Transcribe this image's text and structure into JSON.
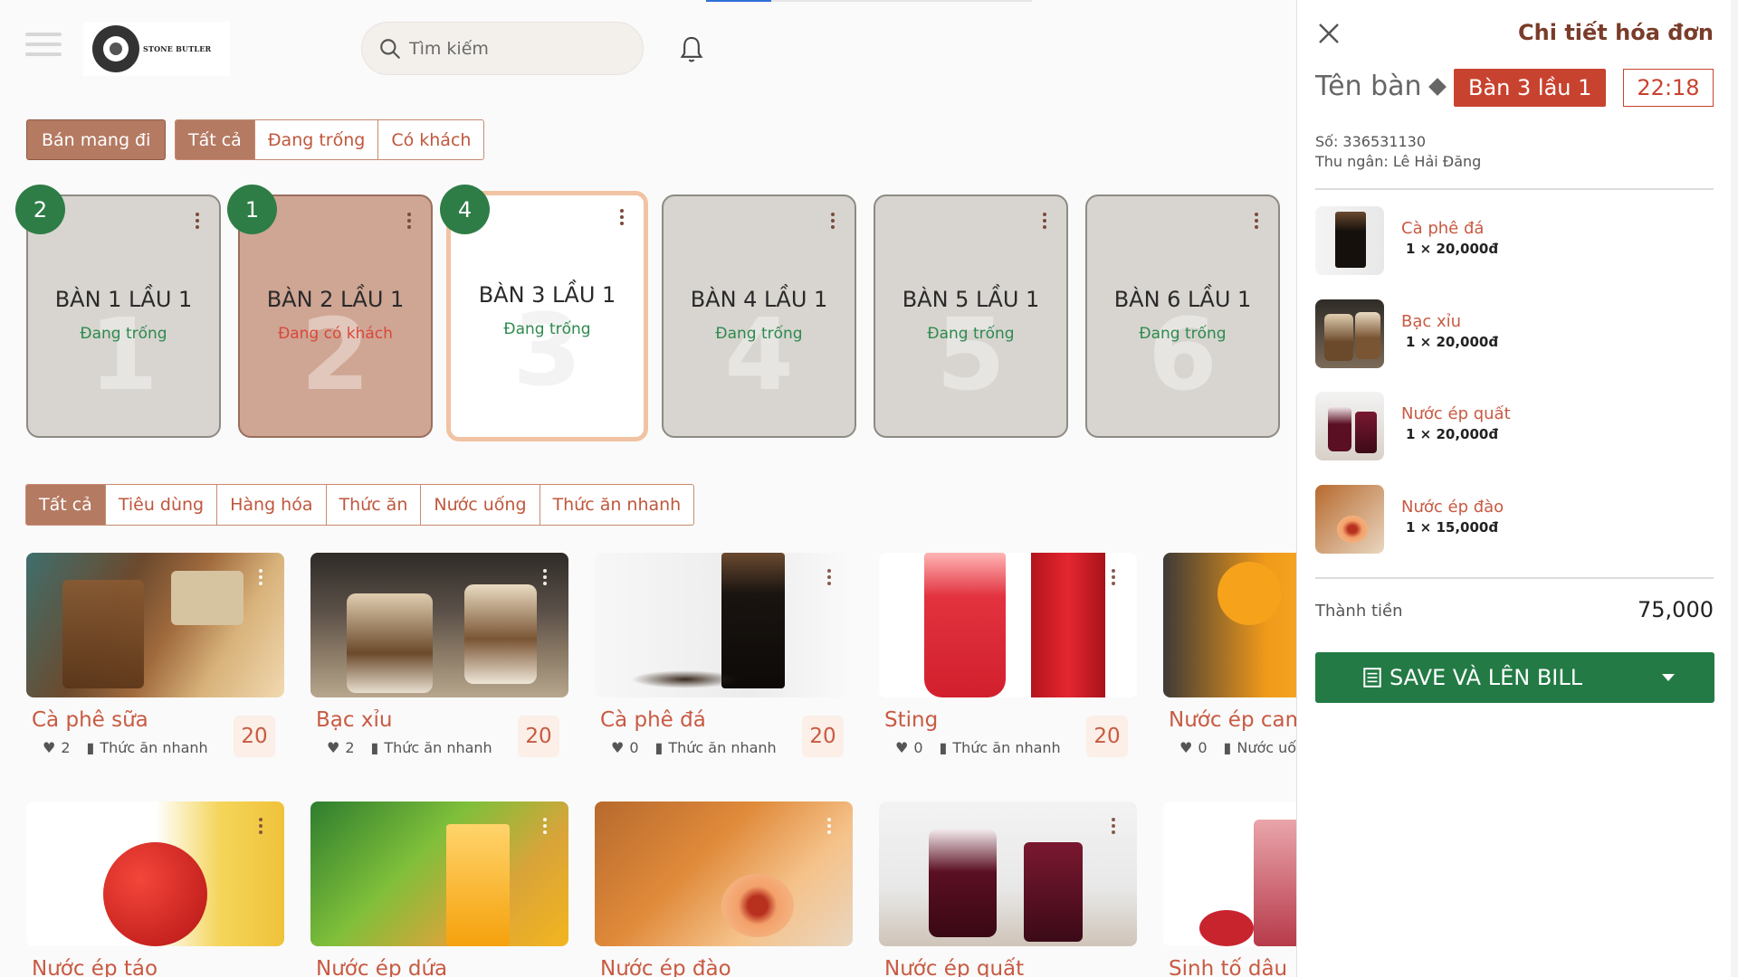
{
  "header": {
    "logo_text": "STONE BUTLER",
    "search_placeholder": "Tìm kiếm"
  },
  "toolbar": {
    "takeaway_label": "Bán mang đi",
    "status_filters": [
      "Tất cả",
      "Đang trống",
      "Có khách"
    ],
    "status_active": "Tất cả"
  },
  "tables": [
    {
      "badge": "2",
      "name": "BÀN 1 LẦU 1",
      "status": "Đang trống",
      "num": "1",
      "state": "free"
    },
    {
      "badge": "1",
      "name": "BÀN 2 LẦU 1",
      "status": "Đang có khách",
      "num": "2",
      "state": "busy"
    },
    {
      "badge": "4",
      "name": "BÀN 3 LẦU 1",
      "status": "Đang trống",
      "num": "3",
      "state": "selected"
    },
    {
      "badge": "",
      "name": "BÀN 4 LẦU 1",
      "status": "Đang trống",
      "num": "4",
      "state": "free"
    },
    {
      "badge": "",
      "name": "BÀN 5 LẦU 1",
      "status": "Đang trống",
      "num": "5",
      "state": "free"
    },
    {
      "badge": "",
      "name": "BÀN 6 LẦU 1",
      "status": "Đang trống",
      "num": "6",
      "state": "free"
    }
  ],
  "categories": [
    "Tất cả",
    "Tiêu dùng",
    "Hàng hóa",
    "Thức ăn",
    "Nước uống",
    "Thức ăn nhanh"
  ],
  "products": [
    {
      "name": "Cà phê sữa",
      "likes": "2",
      "category": "Thức ăn nhanh",
      "price": "20"
    },
    {
      "name": "Bạc xỉu",
      "likes": "2",
      "category": "Thức ăn nhanh",
      "price": "20"
    },
    {
      "name": "Cà phê đá",
      "likes": "0",
      "category": "Thức ăn nhanh",
      "price": "20"
    },
    {
      "name": "Sting",
      "likes": "0",
      "category": "Thức ăn nhanh",
      "price": "20"
    },
    {
      "name": "Nước ép cam",
      "likes": "0",
      "category": "Nước uống",
      "price": ""
    },
    {
      "name": "Nước ép táo",
      "likes": "",
      "category": "",
      "price": ""
    },
    {
      "name": "Nước ép dứa",
      "likes": "",
      "category": "",
      "price": ""
    },
    {
      "name": "Nước ép đào",
      "likes": "",
      "category": "",
      "price": ""
    },
    {
      "name": "Nước ép quất",
      "likes": "",
      "category": "",
      "price": ""
    },
    {
      "name": "Sinh tố dâu",
      "likes": "",
      "category": "",
      "price": ""
    }
  ],
  "invoice": {
    "title": "Chi tiết hóa đơn",
    "table_label": "Tên bàn",
    "table_name": "Bàn 3 lầu 1",
    "time": "22:18",
    "number": "Số: 336531130",
    "cashier": "Thu ngân: Lê Hải Đăng",
    "items": [
      {
        "name": "Cà phê đá",
        "qty": "1 × 20,000đ"
      },
      {
        "name": "Bạc xỉu",
        "qty": "1 × 20,000đ"
      },
      {
        "name": "Nước ép quất",
        "qty": "1 × 20,000đ"
      },
      {
        "name": "Nước ép đào",
        "qty": "1 × 15,000đ"
      }
    ],
    "total_label": "Thành tiền",
    "total_value": "75,000",
    "save_label": "SAVE VÀ LÊN BILL"
  },
  "colors": {
    "accent": "#b47a62",
    "danger": "#c8432f",
    "success": "#237a45"
  }
}
